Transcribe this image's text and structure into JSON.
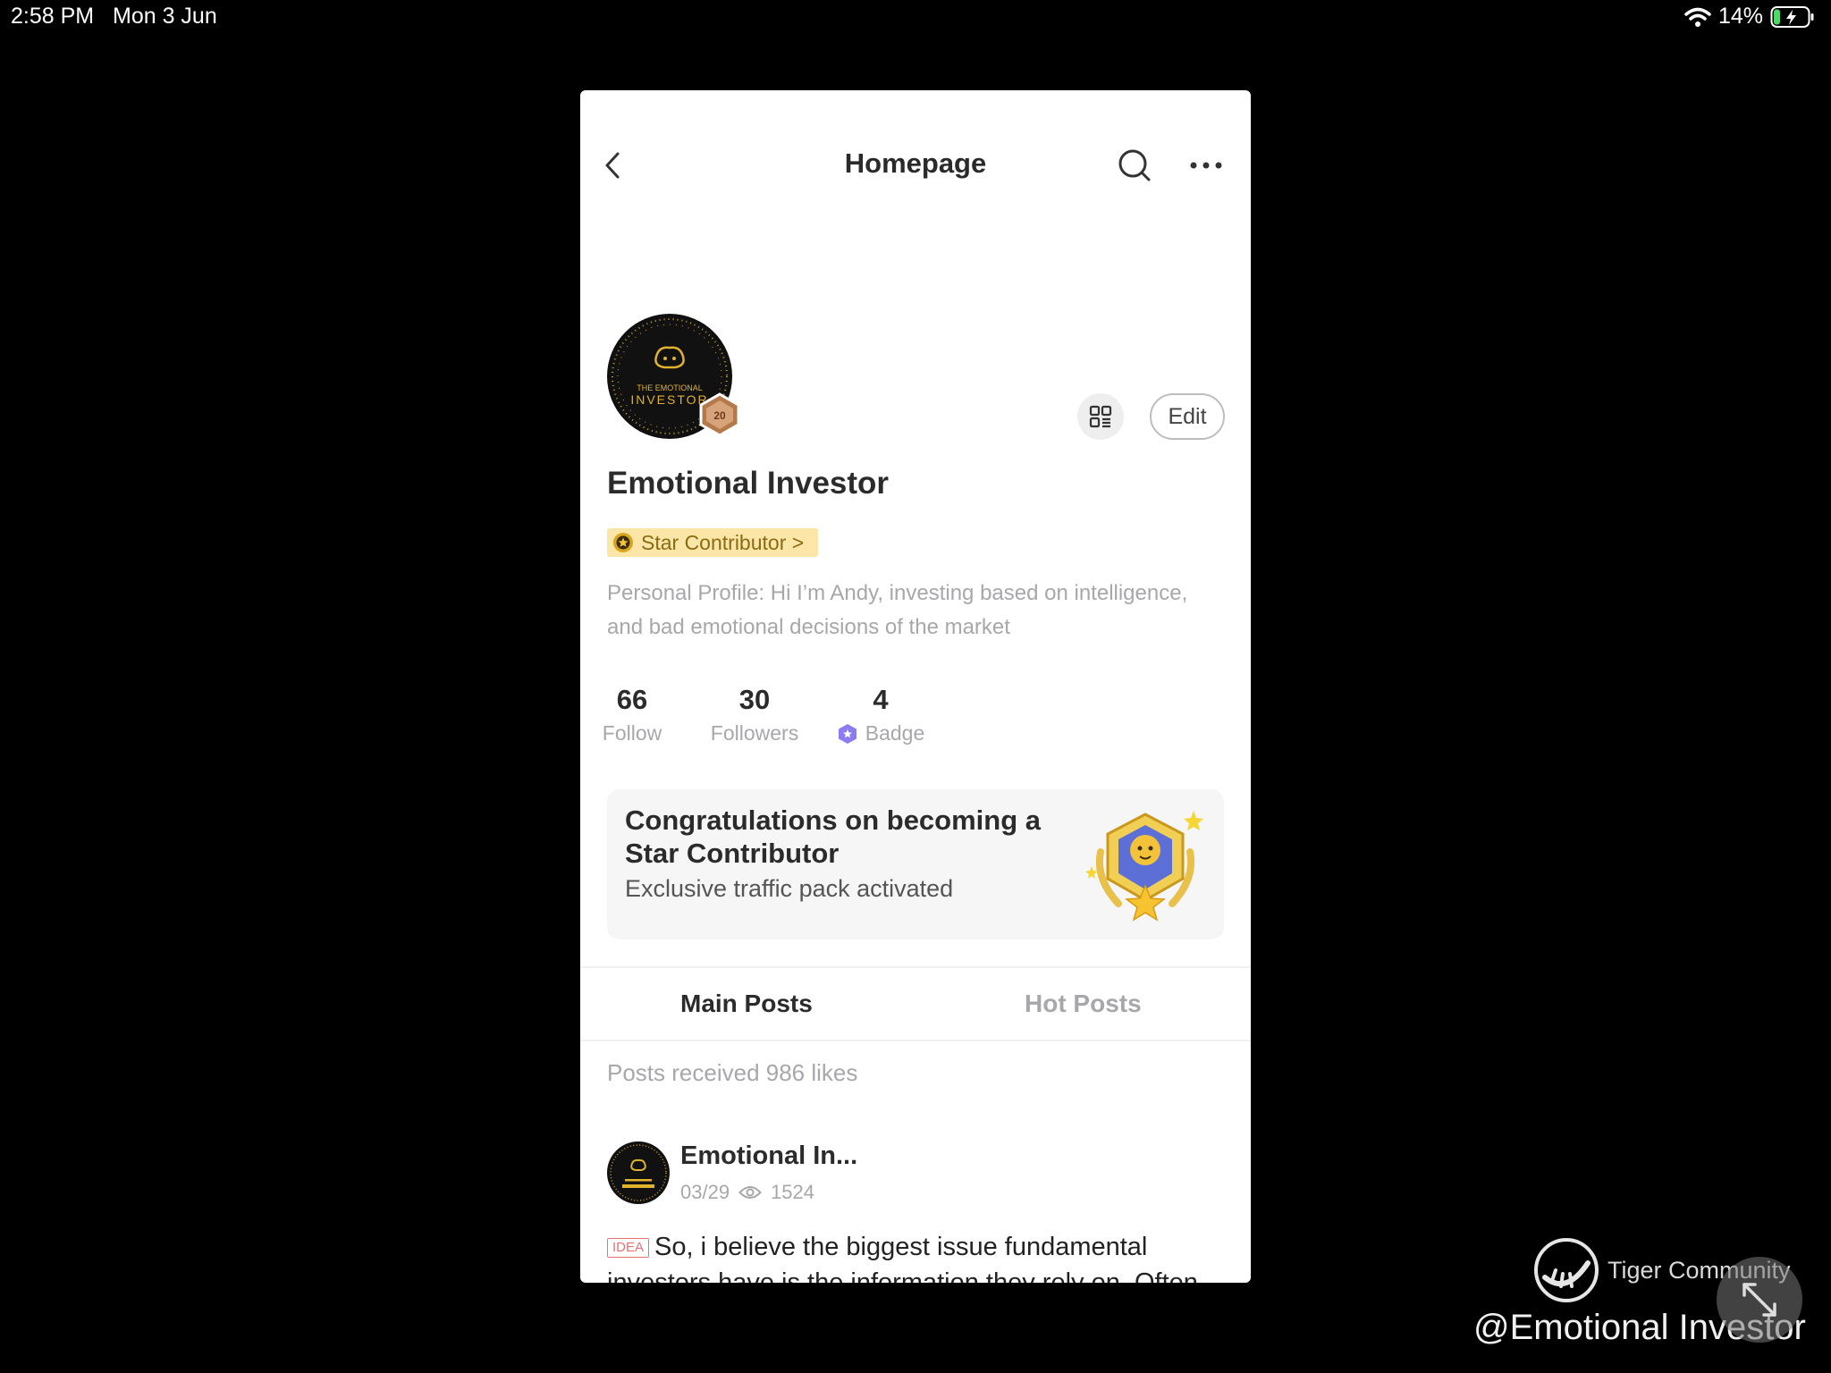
{
  "status_bar": {
    "time": "2:58 PM",
    "date": "Mon 3 Jun",
    "battery": "14%"
  },
  "nav": {
    "title": "Homepage"
  },
  "avatar": {
    "line1": "THE EMOTIONAL",
    "line2": "INVESTOR",
    "level": "20"
  },
  "profile": {
    "edit_label": "Edit",
    "name": "Emotional Investor",
    "tag": "Star Contributor >",
    "bio": "Personal Profile: Hi I’m Andy, investing based on intelligence, and bad emotional decisions of the market"
  },
  "stats": [
    {
      "value": "66",
      "label": "Follow"
    },
    {
      "value": "30",
      "label": "Followers"
    },
    {
      "value": "4",
      "label": "Badge"
    }
  ],
  "congrats": {
    "title": "Congratulations on becoming a Star Contributor",
    "subtitle": "Exclusive traffic pack activated"
  },
  "tabs": [
    {
      "label": "Main Posts"
    },
    {
      "label": "Hot Posts"
    }
  ],
  "likes_text": "Posts received 986 likes",
  "post": {
    "author": "Emotional In...",
    "date": "03/29",
    "views": "1524",
    "tag": "IDEA",
    "text": "So, i believe the biggest issue fundamental investors have is the information they rely on. Often"
  },
  "watermark": {
    "brand": "Tiger Community",
    "handle": "@Emotional Investor"
  },
  "colors": {
    "accent_gold": "#d9a520",
    "tag_bg": "#fbe6a8",
    "muted_text": "#a7a7ac",
    "badge_purple": "#8b7cf0",
    "idea_red": "#e57373"
  }
}
